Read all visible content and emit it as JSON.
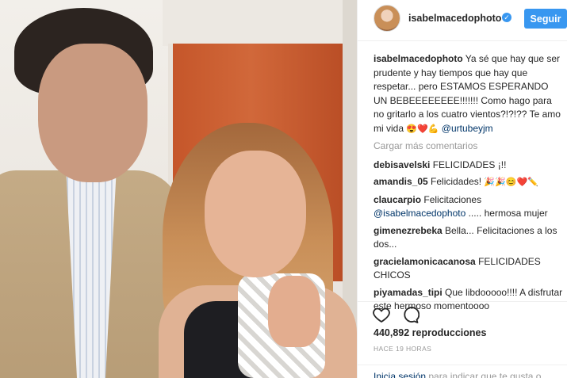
{
  "post": {
    "username": "isabelmacedophoto",
    "verified_icon": "verified-badge-icon",
    "follow_label": "Seguir",
    "caption": {
      "user": "isabelmacedophoto",
      "text": " Ya sé que hay que ser prudente y hay tiempos que hay que respetar... pero ESTAMOS ESPERANDO UN BEBEEEEEEEE!!!!!!! Como hago para no gritarlo a los cuatro vientos?!?!?? Te amo mi vida ",
      "emoji": "😍❤️💪",
      "mention": "@urtubeyjm"
    },
    "load_more": "Cargar más comentarios",
    "comments": [
      {
        "user": "debisavelski",
        "text": " FELICIDADES ¡!!"
      },
      {
        "user": "amandis_05",
        "text": " Felicidades! ",
        "emoji": "🎉🎉😊❤️✏️"
      },
      {
        "user": "claucarpio",
        "text": " Felicitaciones ",
        "mention": "@isabelmacedophoto",
        "after": " ..... hermosa mujer"
      },
      {
        "user": "gimenezrebeka",
        "text": " Bella... Felicitaciones a los dos..."
      },
      {
        "user": "gracielamonicacanosa",
        "text": " FELICIDADES CHICOS"
      },
      {
        "user": "piyamadas_tipi",
        "text": " Que libdooooo!!!! A disfrutar este hermoso momentoooo"
      }
    ],
    "views": "440,892 reproducciones",
    "time": "HACE 19 HORAS",
    "footer": {
      "link": "Inicia sesión",
      "rest": " para indicar que te gusta o"
    },
    "icons": {
      "like": "heart-icon",
      "comment": "comment-icon"
    },
    "colors": {
      "accent": "#3897f0",
      "link": "#003569",
      "muted": "#999999"
    }
  }
}
